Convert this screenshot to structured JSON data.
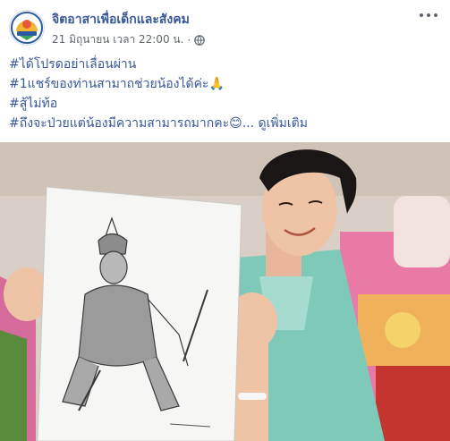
{
  "post": {
    "page_name": "จิตอาสาเพื่อเด็กและสังคม",
    "timestamp": "21 มิถุนายน เวลา 22:00 น.",
    "separator": "·",
    "privacy_icon": "globe-icon",
    "more_icon": "more-horizontal-icon",
    "lines": [
      {
        "text": "#ได้โปรดอย่าเลื่อนผ่าน"
      },
      {
        "text": "#1แชร์ของท่านสามาถช่วยน้องได้ค่ะ🙏"
      },
      {
        "text": "#สู้ไม่ท้อ"
      },
      {
        "text": "#ถึงจะป่วยแต่น้องมีความสามารถมากคะ😊..."
      }
    ],
    "see_more": "ดูเพิ่มเติม",
    "colors": {
      "link": "#385898",
      "meta": "#606770",
      "text": "#1c1e21"
    }
  }
}
